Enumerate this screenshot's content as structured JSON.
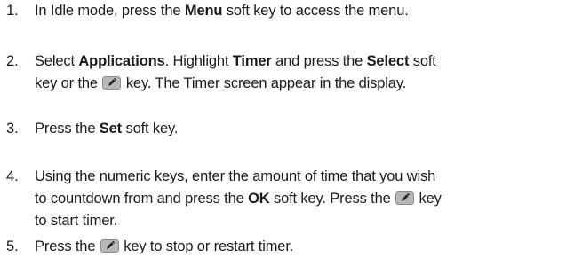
{
  "steps": [
    {
      "number": "1.",
      "lines": [
        [
          {
            "t": "In Idle mode, press the "
          },
          {
            "t": "Menu",
            "b": true
          },
          {
            "t": " soft key to access the menu."
          }
        ]
      ]
    },
    {
      "number": "2.",
      "lines": [
        [
          {
            "t": "Select "
          },
          {
            "t": "Applications",
            "b": true
          },
          {
            "t": ". Highlight "
          },
          {
            "t": "Timer",
            "b": true
          },
          {
            "t": " and press the "
          },
          {
            "t": "Select",
            "b": true
          },
          {
            "t": " soft"
          }
        ],
        [
          {
            "t": "key or the "
          },
          {
            "icon": "ok-key-icon"
          },
          {
            "t": " key. The Timer screen appear in the display."
          }
        ]
      ]
    },
    {
      "number": "3.",
      "lines": [
        [
          {
            "t": "Press the "
          },
          {
            "t": "Set",
            "b": true
          },
          {
            "t": " soft key."
          }
        ]
      ]
    },
    {
      "number": "4.",
      "lines": [
        [
          {
            "t": "Using the numeric keys, enter the amount of time that you wish"
          }
        ],
        [
          {
            "t": "to countdown from and press the "
          },
          {
            "t": "OK",
            "b": true
          },
          {
            "t": " soft key. Press the "
          },
          {
            "icon": "ok-key-icon"
          },
          {
            "t": " key"
          }
        ],
        [
          {
            "t": "to start timer."
          }
        ]
      ]
    },
    {
      "number": "5.",
      "lines": [
        [
          {
            "t": "Press the "
          },
          {
            "icon": "ok-key-icon"
          },
          {
            "t": " key to stop or restart timer."
          }
        ]
      ]
    }
  ],
  "colors": {
    "text": "#1a1a1a",
    "key_fill": "#b8b8b8",
    "key_border": "#8a8a8a",
    "key_glyph": "#222222"
  }
}
